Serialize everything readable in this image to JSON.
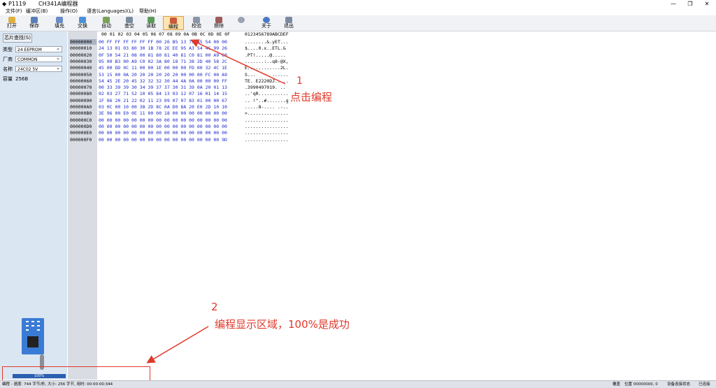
{
  "titlebar": {
    "app_id": "P1119",
    "title": "CH341A编程器",
    "minimize": "—",
    "maximize": "❐",
    "close": "✕"
  },
  "menu": [
    "文件(F)",
    "缓冲区(B)",
    "操作(O)",
    "语言(Languages)(L)",
    "帮助(H)"
  ],
  "toolbar": [
    {
      "label": "打开",
      "icon": "open-icon",
      "color": "#e0b040"
    },
    {
      "label": "保存",
      "icon": "save-icon",
      "color": "#5a7fb8"
    },
    {
      "label": "填充",
      "icon": "fill-icon",
      "color": "#6a8cc8"
    },
    {
      "label": "交换",
      "icon": "swap-icon",
      "color": "#4a90d9"
    },
    {
      "label": "自动",
      "icon": "auto-icon",
      "color": "#7aa05a"
    },
    {
      "label": "查空",
      "icon": "blank-check-icon",
      "color": "#7c8aa0"
    },
    {
      "label": "读取",
      "icon": "read-icon",
      "color": "#5a9a5a"
    },
    {
      "label": "编程",
      "icon": "program-icon",
      "color": "#c85a3a"
    },
    {
      "label": "校验",
      "icon": "verify-icon",
      "color": "#8a96a8"
    },
    {
      "label": "擦除",
      "icon": "erase-icon",
      "color": "#a05a5a"
    },
    {
      "label": "",
      "icon": "stop-icon",
      "color": "#9aa4b0"
    },
    {
      "label": "关于",
      "icon": "about-icon",
      "color": "#4a78c8"
    },
    {
      "label": "退出",
      "icon": "exit-icon",
      "color": "#7a8aa0"
    }
  ],
  "left_panel": {
    "chip_search_button": "芯片查找(S)",
    "type_label": "类型",
    "type_value": "24 EEPROM",
    "maker_label": "厂商",
    "maker_value": "COMMON",
    "name_label": "名称",
    "name_value": "24C02 5V",
    "capacity_label": "容量",
    "capacity_value": "256B",
    "progress_percent": 100,
    "progress_text": "100%"
  },
  "hex_header": "00 01 02 03 04 05 06 07 08 09 0A 0B 0C 0D 0E 0F",
  "ascii_header": "0123456789ABCDEF",
  "rows": [
    {
      "addr": "00000000",
      "hex": "00 FF FF FF FF FF FF 00 26 B5 13 79 A5 54 00 00",
      "ascii": "........&.yET..."
    },
    {
      "addr": "00000010",
      "hex": "24 13 01 03 80 30 1B 78 2E EE 95 A3 54 4C 99 26",
      "ascii": "$....0.x..ETL.&"
    },
    {
      "addr": "00000020",
      "hex": "0F 50 54 21 08 00 81 80 81 40 81 C0 81 00 A9 C0",
      "ascii": ".PT!.....@....."
    },
    {
      "addr": "00000030",
      "hex": "95 00 B3 00 A9 C0 02 3A 80 18 71 38 2D 40 58 2C",
      "ascii": ".......:..q8-@X,"
    },
    {
      "addr": "00000040",
      "hex": "45 00 DD 0C 11 00 00 1E 00 00 00 FD 00 32 4C 1E",
      "ascii": "E............2L."
    },
    {
      "addr": "00000050",
      "hex": "53 15 00 0A 20 20 20 20 20 20 00 00 00 FC 00 A9",
      "ascii": "S...      ......"
    },
    {
      "addr": "00000060",
      "hex": "54 45 2E 20 45 32 32 32 30 44 4A 0A 00 00 00 FF",
      "ascii": "TE. E2220DJ....."
    },
    {
      "addr": "00000070",
      "hex": "00 33 39 39 30 34 39 37 37 30 31 39 0A 20 01 13",
      "ascii": ".3990497019. .."
    },
    {
      "addr": "00000080",
      "hex": "02 03 27 71 52 10 05 84 13 03 12 07 16 01 14 15",
      "ascii": "..'qR..........."
    },
    {
      "addr": "00000090",
      "hex": "1F 06 20 21 22 02 11 23 09 07 07 83 01 00 00 67",
      "ascii": ".. !\"..#.......g"
    },
    {
      "addr": "000000A0",
      "hex": "03 0C 00 10 00 38 2D 8C 0A D0 8A 20 E0 2D 10 10",
      "ascii": ".....8-.... .-.."
    },
    {
      "addr": "000000B0",
      "hex": "3E 96 00 E0 0E 11 00 00 18 00 00 00 00 00 00 00",
      "ascii": ">..............."
    },
    {
      "addr": "000000C0",
      "hex": "00 00 00 00 00 00 00 00 00 00 00 00 00 00 00 00",
      "ascii": "................"
    },
    {
      "addr": "000000D0",
      "hex": "00 00 00 00 00 00 00 00 00 00 00 00 00 00 00 00",
      "ascii": "................"
    },
    {
      "addr": "000000E0",
      "hex": "00 00 00 00 00 00 00 00 00 00 00 00 00 00 00 00",
      "ascii": "................"
    },
    {
      "addr": "000000F0",
      "hex": "00 00 00 00 00 00 00 00 00 00 00 00 00 00 00 9D",
      "ascii": "................"
    }
  ],
  "annotations": {
    "num1": "1",
    "text1": "点击编程",
    "num2": "2",
    "text2": "编程显示区域，100%是成功",
    "color": "#e0392b"
  },
  "status": {
    "left": "编程 - 速度: 744 字节/秒, 大小: 256 字节, 用时: 00:00:00:344",
    "overwrite": "覆盖",
    "position": "位置 00000000, 0",
    "device": "设备连接状态",
    "connected": "已连接"
  }
}
